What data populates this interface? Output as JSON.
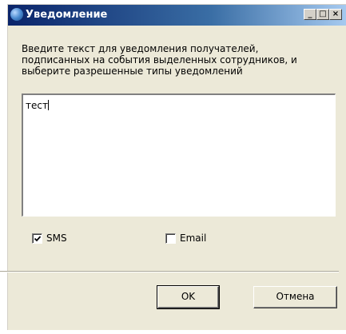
{
  "window": {
    "title": "Уведомление",
    "controls": {
      "minimize": "_",
      "maximize": "□",
      "close": "×"
    }
  },
  "instructions": [
    "Введите текст для уведомления получателей,",
    "подписанных на события выделенных сотрудников, и",
    "выберите разрешенные типы уведомлений"
  ],
  "message": {
    "value": "тест"
  },
  "options": {
    "sms": {
      "label": "SMS",
      "checked": true
    },
    "email": {
      "label": "Email",
      "checked": false
    }
  },
  "buttons": {
    "ok": "OK",
    "cancel": "Отмена"
  }
}
